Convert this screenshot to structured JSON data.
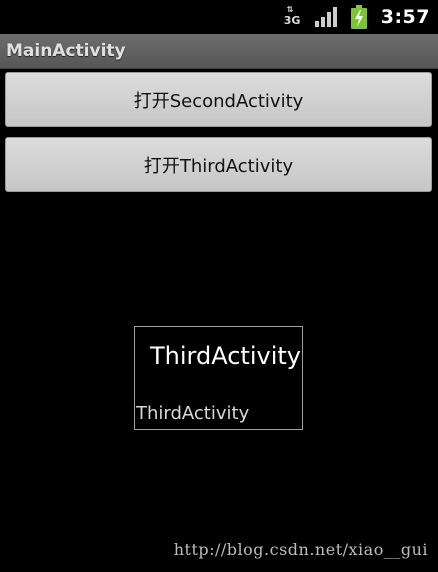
{
  "status_bar": {
    "network_label": "3G",
    "time": "3:57",
    "battery_color": "#7cc431",
    "icons": [
      "network-3g-icon",
      "signal-strength-icon",
      "battery-charging-icon"
    ]
  },
  "title_bar": {
    "title": "MainActivity"
  },
  "buttons": {
    "open_second": "打开SecondActivity",
    "open_third": "打开ThirdActivity"
  },
  "dialog": {
    "title": "ThirdActivity",
    "body": "ThirdActivity"
  },
  "watermark": {
    "text": "http://blog.csdn.net/xiao__gui"
  }
}
